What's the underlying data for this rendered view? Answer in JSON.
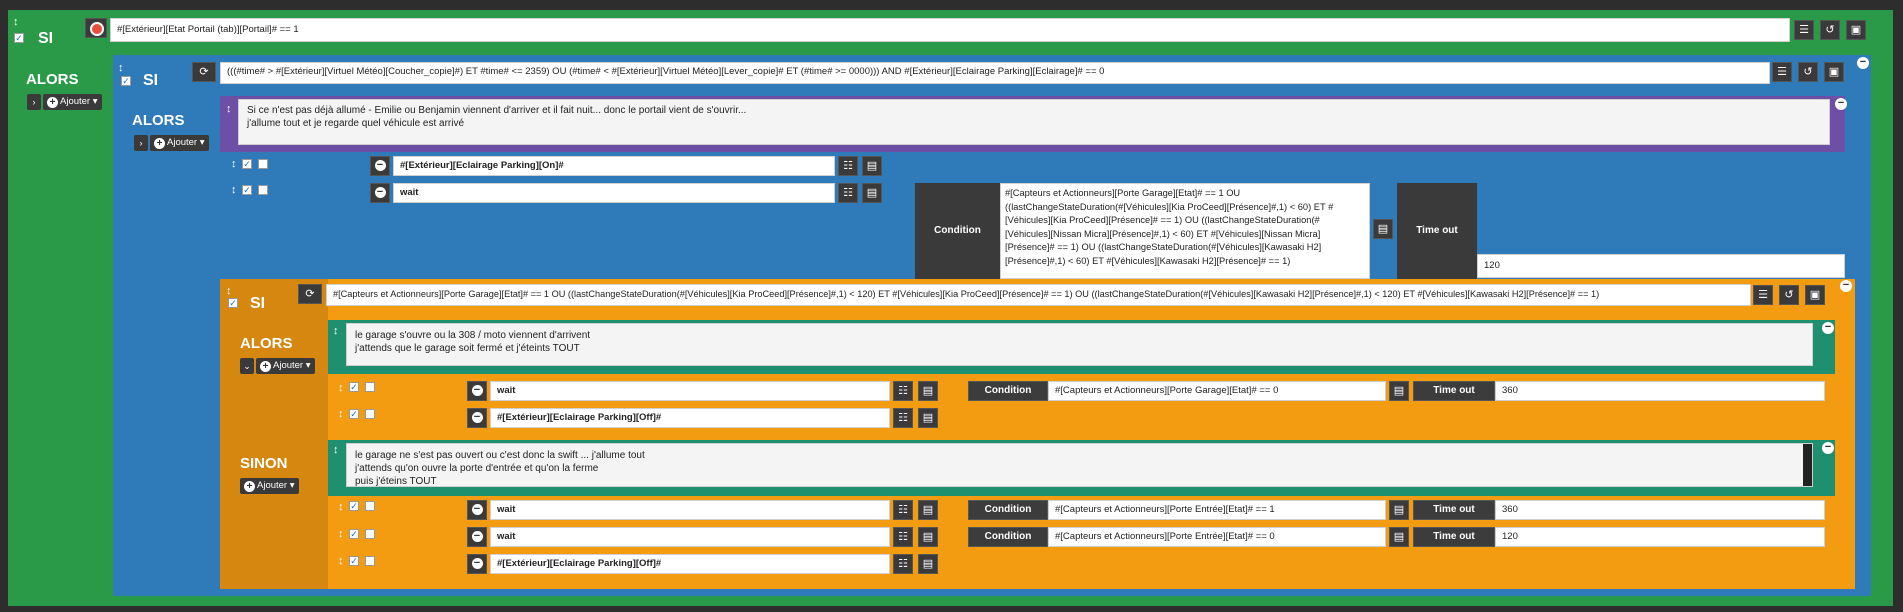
{
  "root": {
    "si_label": "SI",
    "condition": "#[Extérieur][Etat Portail (tab)][Portail]# == 1",
    "alors_label": "ALORS",
    "ajouter_label": "Ajouter"
  },
  "si2": {
    "label": "SI",
    "condition": "(((#time# > #[Extérieur][Virtuel Météo][Coucher_copie]#) ET #time# <= 2359) OU (#time# < #[Extérieur][Virtuel Météo][Lever_copie]# ET (#time# >= 0000))) AND #[Extérieur][Eclairage Parking][Eclairage]# == 0",
    "alors_label": "ALORS",
    "ajouter_label": "Ajouter",
    "comment": "Si ce n'est pas déjà allumé - Emilie ou Benjamin viennent d'arriver et il fait nuit... donc le portail vient de s'ouvrir...\nj'allume tout et je regarde quel véhicule est arrivé",
    "action1": "#[Extérieur][Eclairage Parking][On]#",
    "action2": "wait",
    "condition_label": "Condition",
    "wait_condition": "#[Capteurs et Actionneurs][Porte Garage][Etat]# == 1 OU\n((lastChangeStateDuration(#[Véhicules][Kia ProCeed][Présence]#,1) < 60) ET #\n[Véhicules][Kia ProCeed][Présence]# == 1) OU ((lastChangeStateDuration(#\n[Véhicules][Nissan Micra][Présence]#,1) < 60) ET #[Véhicules][Nissan Micra]\n[Présence]# == 1) OU ((lastChangeStateDuration(#[Véhicules][Kawasaki H2]\n[Présence]#,1) < 60) ET #[Véhicules][Kawasaki H2][Présence]# == 1)",
    "timeout_label": "Time out",
    "timeout_value": "120"
  },
  "si3": {
    "label": "SI",
    "condition": "#[Capteurs et Actionneurs][Porte Garage][Etat]# == 1 OU ((lastChangeStateDuration(#[Véhicules][Kia ProCeed][Présence]#,1) < 120) ET #[Véhicules][Kia ProCeed][Présence]# == 1) OU ((lastChangeStateDuration(#[Véhicules][Kawasaki H2][Présence]#,1) < 120) ET #[Véhicules][Kawasaki H2][Présence]# == 1)",
    "alors_label": "ALORS",
    "sinon_label": "SINON",
    "ajouter_label": "Ajouter",
    "alors_comment": "le garage s'ouvre ou la 308 / moto viennent d'arrivent\nj'attends que le garage soit fermé et j'éteints TOUT",
    "alors_wait": "wait",
    "alors_cond_label": "Condition",
    "alors_cond": "#[Capteurs et Actionneurs][Porte Garage][Etat]# == 0",
    "alors_timeout_label": "Time out",
    "alors_timeout": "360",
    "alors_action": "#[Extérieur][Eclairage Parking][Off]#",
    "sinon_comment": "le garage ne s'est pas ouvert ou c'est donc la swift ... j'allume tout\nj'attends qu'on ouvre la porte d'entrée et qu'on la ferme\npuis j'éteins TOUT",
    "sinon_wait1": "wait",
    "sinon_cond1_label": "Condition",
    "sinon_cond1": "#[Capteurs et Actionneurs][Porte Entrée][Etat]# == 1",
    "sinon_timeout1_label": "Time out",
    "sinon_timeout1": "360",
    "sinon_wait2": "wait",
    "sinon_cond2_label": "Condition",
    "sinon_cond2": "#[Capteurs et Actionneurs][Porte Entrée][Etat]# == 0",
    "sinon_timeout2_label": "Time out",
    "sinon_timeout2": "120",
    "sinon_action": "#[Extérieur][Eclairage Parking][Off]#"
  },
  "colors": {
    "green": "#2a9a48",
    "blue": "#2f7ab8",
    "purple": "#6d4fa5",
    "orange": "#f39c12",
    "orange_dark": "#d5870f",
    "teal": "#1e9070"
  }
}
